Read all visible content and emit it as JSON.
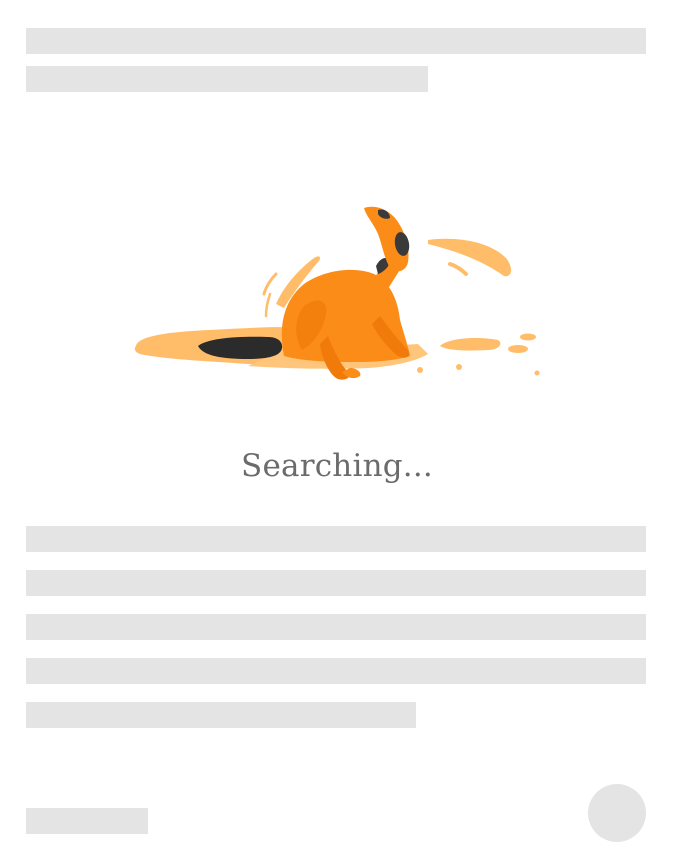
{
  "status": {
    "text": "Searching..."
  },
  "colors": {
    "skeleton": "#e4e4e4",
    "dog_orange": "#fb8c17",
    "dog_shadow": "#f07a0a",
    "sand": "#ffbd6a",
    "hole": "#2b2b2b",
    "text": "#6b6b6b"
  },
  "illustration": {
    "icon": "digging-dog-icon"
  }
}
